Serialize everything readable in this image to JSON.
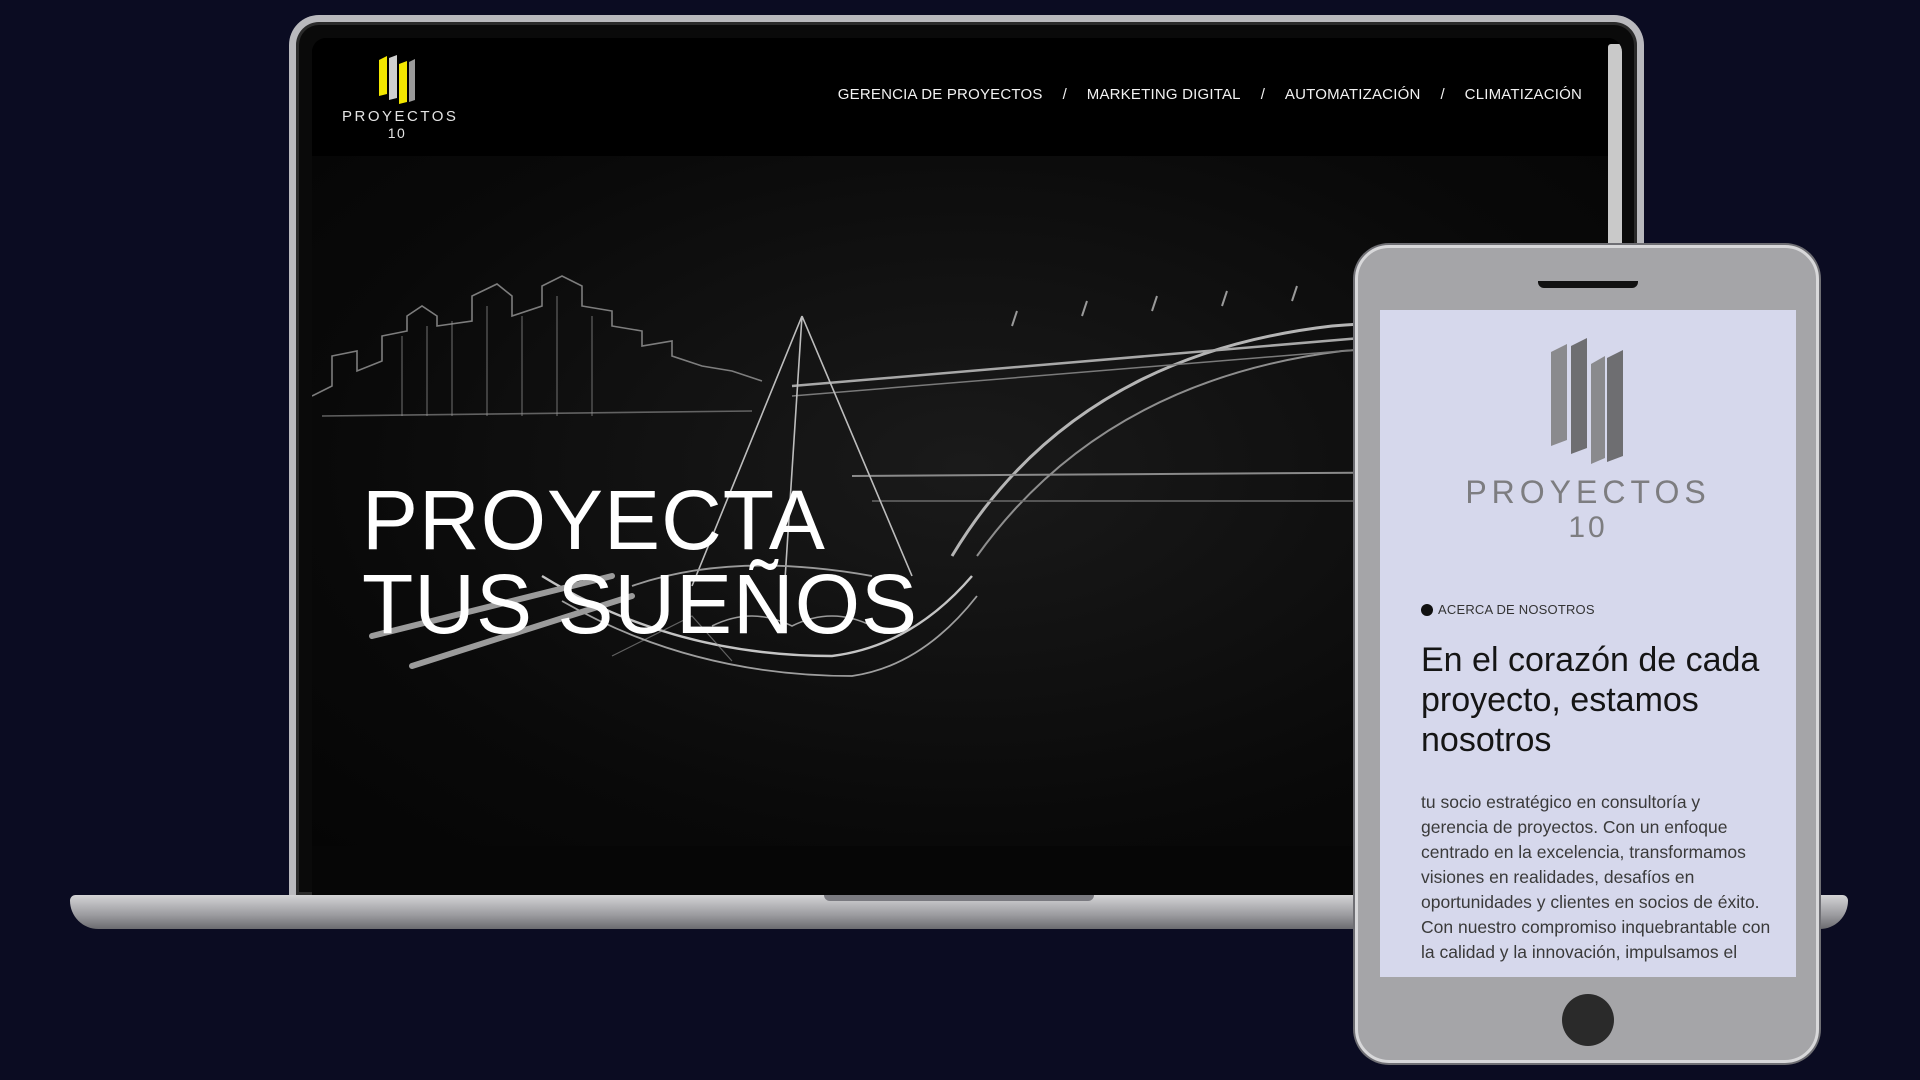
{
  "site": {
    "logo": {
      "word": "PROYECTOS",
      "number": "10",
      "accent_color": "#f2e600"
    },
    "nav": [
      {
        "label": "GERENCIA DE PROYECTOS"
      },
      {
        "label": "MARKETING DIGITAL"
      },
      {
        "label": "AUTOMATIZACIÓN"
      },
      {
        "label": "CLIMATIZACIÓN"
      }
    ],
    "nav_separator": "/",
    "hero": {
      "line1": "PROYECTA",
      "line2": "TUS SUEÑOS"
    }
  },
  "mobile": {
    "logo": {
      "word": "PROYECTOS",
      "number": "10"
    },
    "about_label": "ACERCA DE NOSOTROS",
    "about_heading": "En el corazón de cada proyecto, estamos nosotros",
    "about_text": "tu socio estratégico en consultoría y gerencia de proyectos. Con un enfoque centrado en la excelencia, transformamos visiones en realidades, desafíos en oportunidades y clientes en socios de éxito. Con nuestro compromiso inquebrantable con la calidad y la innovación, impulsamos el"
  },
  "colors": {
    "background": "#0b0c22",
    "device_frame": "#b9b9bd",
    "phone_screen": "#d6d8ec"
  }
}
